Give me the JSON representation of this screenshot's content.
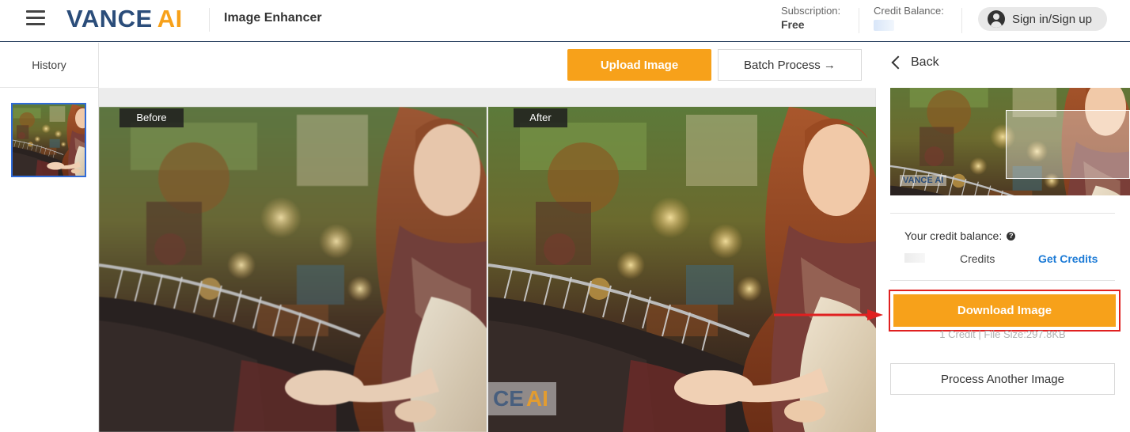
{
  "header": {
    "logo_main": "VANCE",
    "logo_accent": "AI",
    "app_name": "Image Enhancer",
    "subscription_label": "Subscription:",
    "subscription_value": "Free",
    "credit_balance_label": "Credit Balance:",
    "sign_in_label": "Sign in/Sign up"
  },
  "sidebar": {
    "title": "History"
  },
  "toolbar": {
    "upload_label": "Upload Image",
    "batch_label": "Batch Process →"
  },
  "compare": {
    "before_label": "Before",
    "after_label": "After",
    "watermark_main": "CE",
    "watermark_accent": "AI"
  },
  "right_panel": {
    "back_label": "Back",
    "preview_watermark": "VANCE AI",
    "credit_balance_label": "Your credit balance:",
    "help_glyph": "?",
    "credits_word": "Credits",
    "get_credits_label": "Get Credits",
    "download_label": "Download Image",
    "download_sub": "1 Credit | File Size:297.8KB",
    "process_another_label": "Process Another Image"
  },
  "colors": {
    "accent_orange": "#f7a11a",
    "brand_blue": "#2b4d7a",
    "link_blue": "#1d7bd6",
    "highlight_red": "#e02020"
  },
  "icons": {
    "menu": "hamburger-icon",
    "user": "user-circle-icon",
    "back": "chevron-left-icon",
    "help": "question-circle-icon"
  }
}
